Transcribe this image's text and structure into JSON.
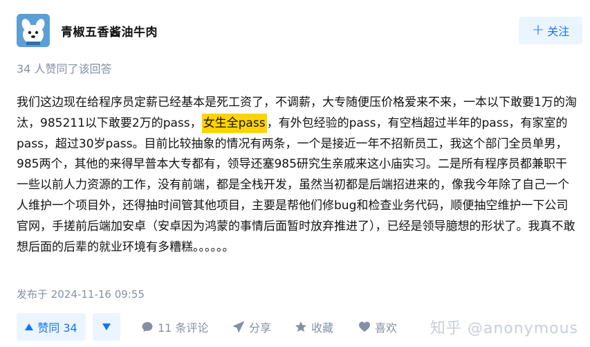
{
  "author": {
    "name": "青椒五香酱油牛肉",
    "follow_label": "关注"
  },
  "upvote_note": "34 人赞同了该回答",
  "content": {
    "before": "我们这边现在给程序员定薪已经基本是死工资了，不调薪，大专随便压价格爱来不来，一本以下敢要1万的淘汰，985211以下敢要2万的pass，",
    "highlight": "女生全pass",
    "after": "，有外包经验的pass，有空档超过半年的pass，有家室的pass，超过30岁pass。目前比较抽象的情况有两条，一个是接近一年不招新员工，我这个部门全员单男，985两个，其他的来得早普本大专都有，领导还塞985研究生亲戚来这小庙实习。二是所有程序员都兼职干一些以前人力资源的工作，没有前端，都是全栈开发，虽然当初都是后端招进来的，像我今年除了自己一个人维护一个项目外，还得抽时间管其他项目，主要是帮他们修bug和检查业务代码，顺便抽空维护一下公司官网，手搓前后端加安卓（安卓因为鸿蒙的事情后面暂时放弃推进了），已经是领导臆想的形状了。我真不敢想后面的后辈的就业环境有多糟糕。。。。。。"
  },
  "published": "发布于 2024-11-16 09:55",
  "actions": {
    "upvote_label": "赞同 34",
    "comments": "11 条评论",
    "share": "分享",
    "collect": "收藏",
    "like": "喜欢"
  },
  "watermark": "知乎 @anonymous",
  "colors": {
    "accent": "#1772f6",
    "accent_bg": "#ebf5ff",
    "muted": "#8590a6",
    "highlight": "#ffd400"
  }
}
